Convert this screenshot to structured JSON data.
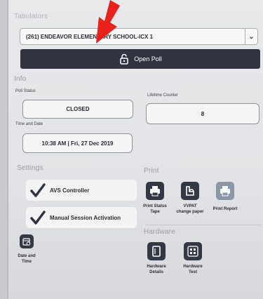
{
  "tabulators": {
    "section_label": "Tabulators",
    "selected_value": "(261) ENDEAVOR ELEMENTARY SCHOOL-ICX 1",
    "open_poll_label": "Open Poll"
  },
  "info": {
    "section_label": "Info",
    "poll_status_label": "Poll Status",
    "poll_status_value": "CLOSED",
    "lifetime_counter_label": "Lifetime Counter",
    "lifetime_counter_value": "8",
    "time_date_label": "Time and Date",
    "time_date_value": "10:38 AM | Fri, 27 Dec 2019"
  },
  "settings": {
    "section_label": "Settings",
    "items": [
      {
        "label": "AVS Controller",
        "checked": true
      },
      {
        "label": "Manual Session Activation",
        "checked": true
      }
    ],
    "date_time_label_line1": "Date and",
    "date_time_label_line2": "Time"
  },
  "print": {
    "section_label": "Print",
    "buttons": [
      {
        "label_line1": "Print Status",
        "label_line2": "Tape",
        "icon": "printer-icon"
      },
      {
        "label_line1": "VVPAT",
        "label_line2": "change paper",
        "icon": "paper-roll-icon"
      },
      {
        "label_line1": "Print Report",
        "label_line2": "",
        "icon": "printer-icon",
        "disabled": true
      }
    ]
  },
  "hardware": {
    "section_label": "Hardware",
    "buttons": [
      {
        "label_line1": "Hardware",
        "label_line2": "Details",
        "icon": "device-icon"
      },
      {
        "label_line1": "Hardware",
        "label_line2": "Test",
        "icon": "grid-test-icon"
      }
    ]
  },
  "colors": {
    "dark_button": "#2f3440",
    "disabled_tile": "#8b97a6",
    "annotation_arrow": "#e8211b"
  }
}
